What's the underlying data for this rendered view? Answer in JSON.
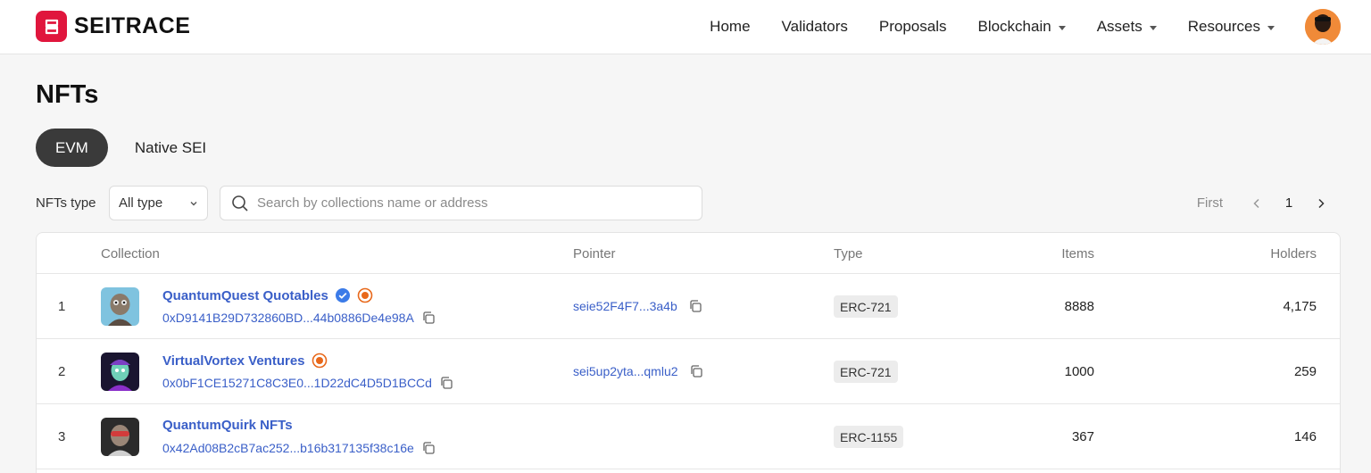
{
  "app": {
    "name": "SEITRACE"
  },
  "nav": {
    "items": [
      {
        "label": "Home",
        "dropdown": false
      },
      {
        "label": "Validators",
        "dropdown": false
      },
      {
        "label": "Proposals",
        "dropdown": false
      },
      {
        "label": "Blockchain",
        "dropdown": true
      },
      {
        "label": "Assets",
        "dropdown": true
      },
      {
        "label": "Resources",
        "dropdown": true
      }
    ]
  },
  "page": {
    "title": "NFTs"
  },
  "tabs": [
    {
      "label": "EVM",
      "active": true
    },
    {
      "label": "Native SEI",
      "active": false
    }
  ],
  "filters": {
    "type_label": "NFTs type",
    "type_value": "All type",
    "search_placeholder": "Search by collections name or address"
  },
  "pagination": {
    "first": "First",
    "current": "1"
  },
  "table": {
    "headers": {
      "collection": "Collection",
      "pointer": "Pointer",
      "type": "Type",
      "items": "Items",
      "holders": "Holders"
    },
    "rows": [
      {
        "index": "1",
        "name": "QuantumQuest Quotables",
        "verified": true,
        "icon": "orange-ring",
        "address": "0xD9141B29D732860BD...44b0886De4e98A",
        "pointer": "seie52F4F7...3a4b",
        "type": "ERC-721",
        "items": "8888",
        "holders": "4,175"
      },
      {
        "index": "2",
        "name": "VirtualVortex Ventures",
        "verified": false,
        "icon": "orange-ring",
        "address": "0x0bF1CE15271C8C3E0...1D22dC4D5D1BCCd",
        "pointer": "sei5up2yta...qmlu2",
        "type": "ERC-721",
        "items": "1000",
        "holders": "259"
      },
      {
        "index": "3",
        "name": "QuantumQuirk NFTs",
        "verified": false,
        "icon": "",
        "address": "0x42Ad08B2cB7ac252...b16b317135f38c16e",
        "pointer": "",
        "type": "ERC-1155",
        "items": "367",
        "holders": "146"
      }
    ]
  },
  "colors": {
    "brand": "#e0163d",
    "link": "#3a5fc8",
    "verified": "#3b7be8",
    "ring": "#e8681a"
  }
}
